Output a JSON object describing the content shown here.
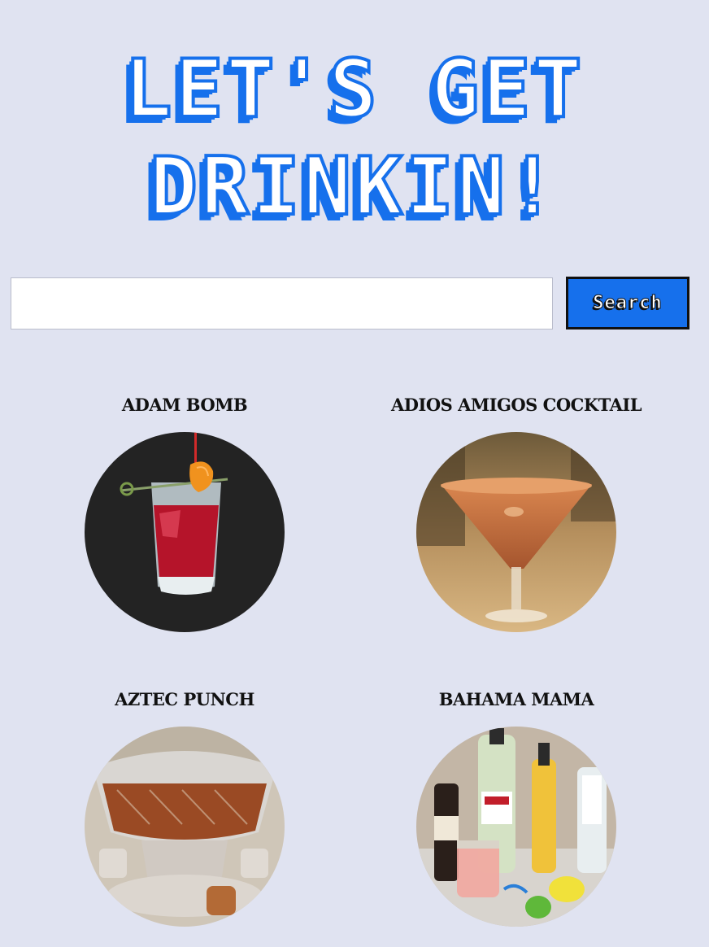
{
  "header": {
    "title_line1": "LET'S GET",
    "title_line2": "DRINKIN!"
  },
  "search": {
    "value": "",
    "placeholder": "",
    "button_label": "Search"
  },
  "drinks": [
    {
      "name": "ADAM BOMB"
    },
    {
      "name": "ADIOS AMIGOS COCKTAIL"
    },
    {
      "name": "AZTEC PUNCH"
    },
    {
      "name": "BAHAMA MAMA"
    }
  ],
  "colors": {
    "background": "#e0e3f1",
    "accent": "#1670ec",
    "text": "#111111"
  }
}
